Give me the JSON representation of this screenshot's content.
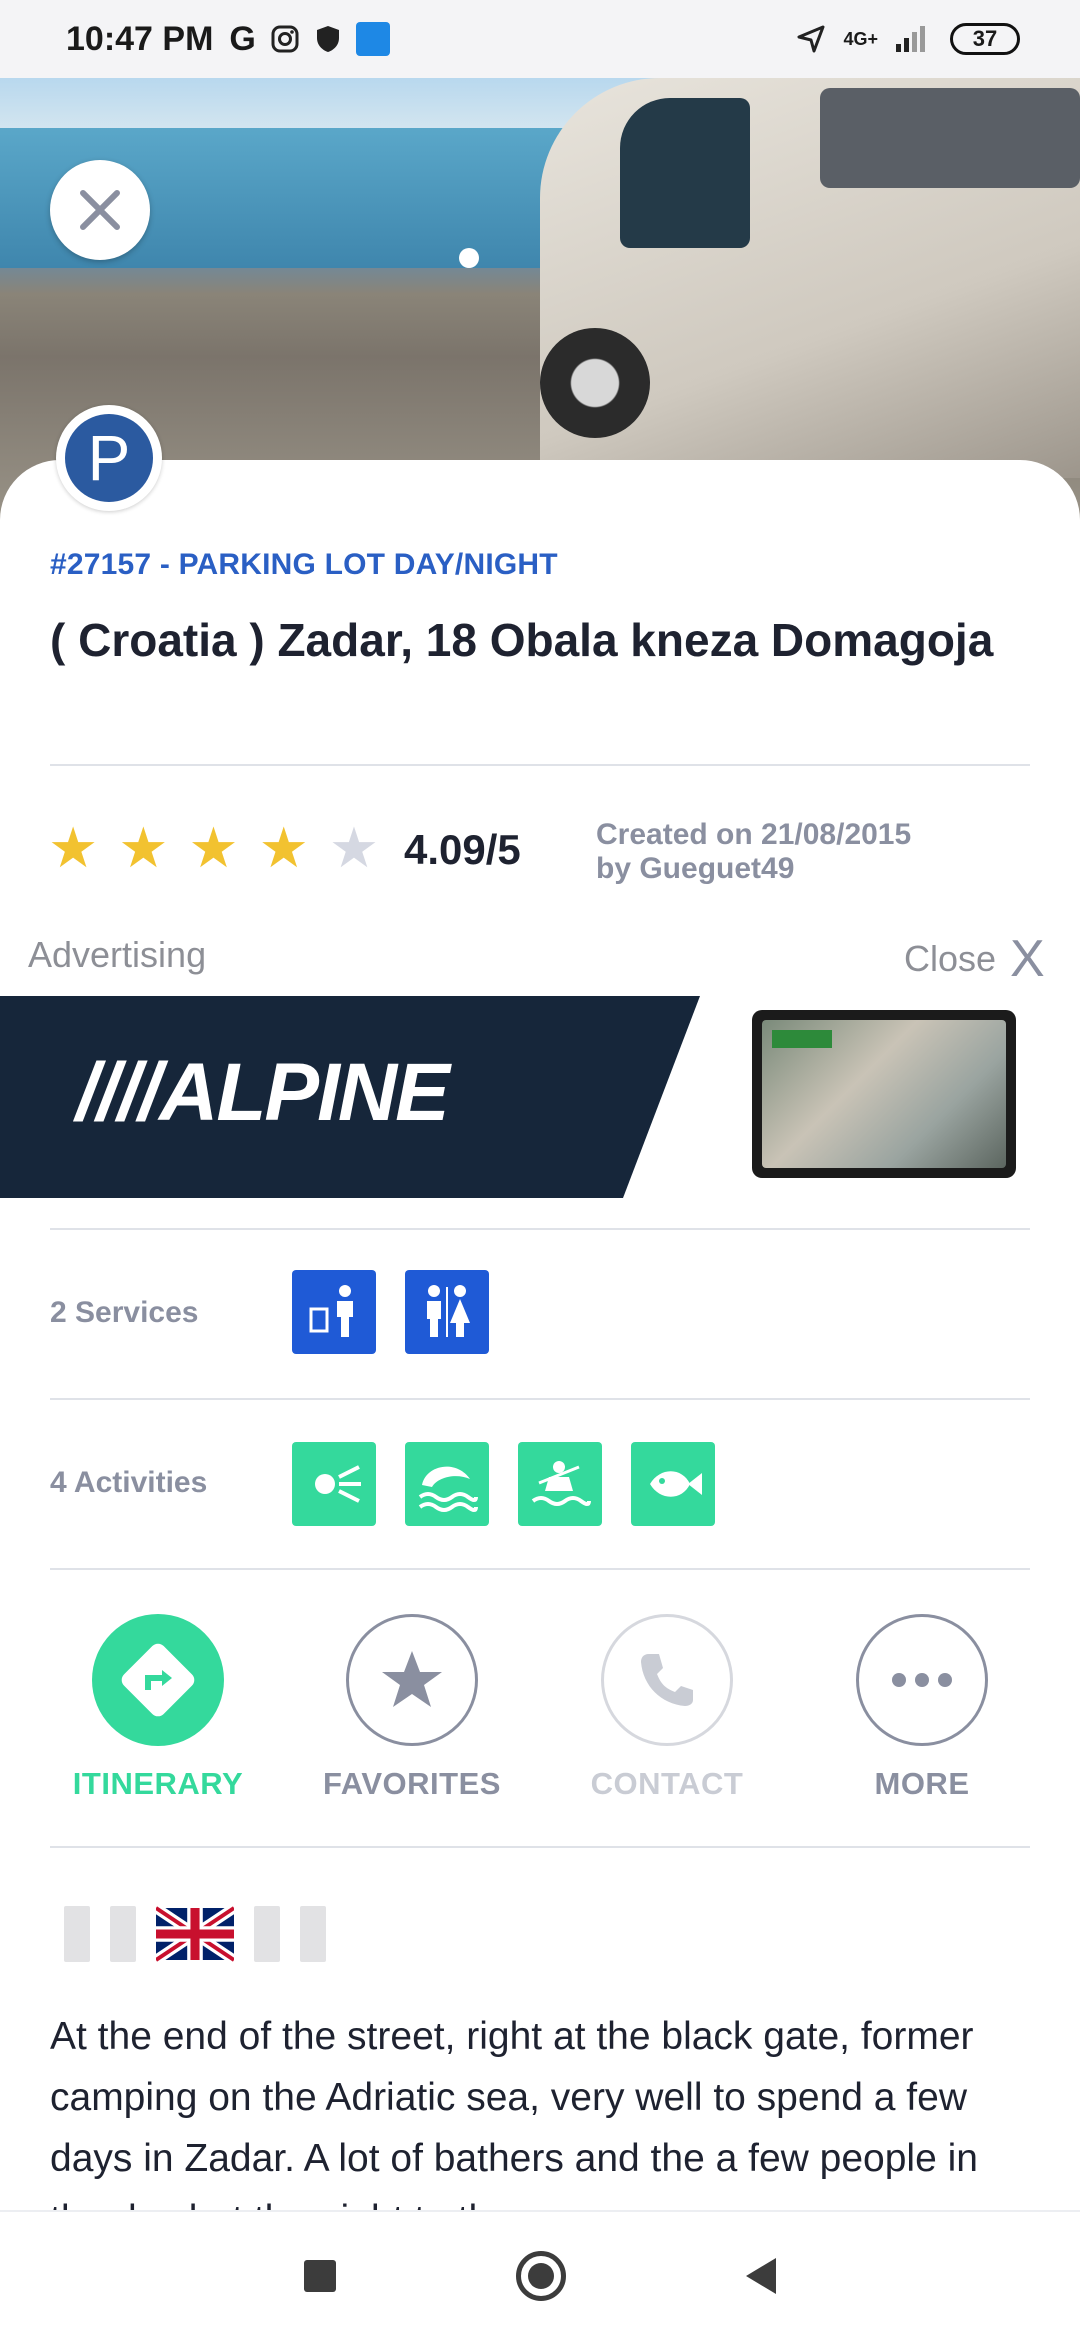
{
  "status_bar": {
    "time": "10:47 PM",
    "network": "4G+",
    "battery": "37"
  },
  "header": {
    "subtitle": "#27157 - PARKING LOT DAY/NIGHT",
    "title": "( Croatia ) Zadar, 18 Obala kneza Domagoja",
    "badge_letter": "P"
  },
  "rating": {
    "score": "4.09/5",
    "stars_filled": 4,
    "stars_total": 5,
    "created_line1": "Created on 21/08/2015",
    "created_line2": "by Gueguet49"
  },
  "ad": {
    "label": "Advertising",
    "close_label": "Close",
    "close_glyph": "X",
    "brand": "////ALPINE"
  },
  "services": {
    "label": "2 Services",
    "icons": [
      "trash-person-icon",
      "toilets-icon"
    ]
  },
  "activities": {
    "label": "4 Activities",
    "icons": [
      "beach-sun-icon",
      "swimming-icon",
      "boating-icon",
      "fishing-icon"
    ]
  },
  "actions": {
    "itinerary": "ITINERARY",
    "favorites": "FAVORITES",
    "contact": "CONTACT",
    "more": "MORE"
  },
  "description": "At the end of the street, right at the black gate, former camping on the Adriatic sea, very well to spend a few days in Zadar. A lot of bathers and the a few people in the day but the night to the",
  "colors": {
    "accent_blue": "#2a5fc4",
    "service_blue": "#1f5ad6",
    "activity_green": "#34d99c",
    "star_gold": "#f2c230",
    "muted_gray": "#8a8fa0"
  }
}
